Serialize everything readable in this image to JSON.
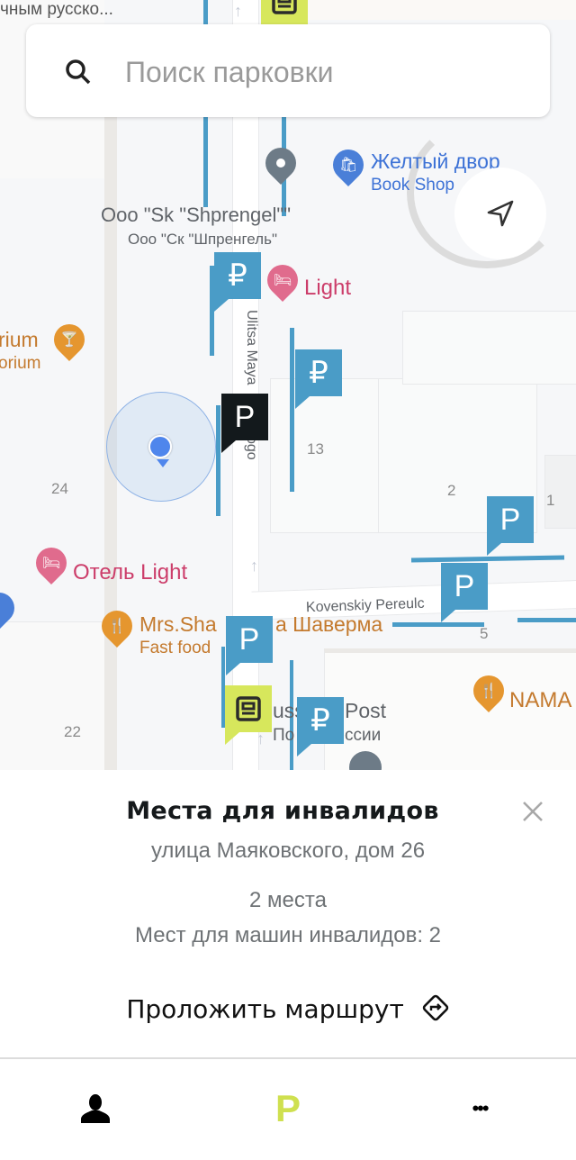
{
  "search": {
    "placeholder": "Поиск парковки"
  },
  "map": {
    "top_label": "чным русско...",
    "pois": [
      {
        "name": "Желтый двор",
        "sub": "Book Shop",
        "icon": "shopping-bag-icon",
        "color": "#4a7fd8"
      },
      {
        "name": "Ooo \"Sk \"Shprengel\"\"",
        "sub": "Ooo \"Ск \"Шпренгель\"",
        "icon": "place-pin-icon",
        "color": "#6d7b87"
      },
      {
        "name": "Light",
        "icon": "hotel-bed-icon",
        "color": "#d9486f"
      },
      {
        "name": "rium",
        "sub": "orium",
        "icon": "cocktail-icon",
        "color": "#e5962f"
      },
      {
        "name": "Отель Light",
        "icon": "hotel-bed-icon",
        "color": "#d9486f"
      },
      {
        "name": "Mrs.Shaverma Шаверма",
        "name_visible_left": "Mrs.Sha",
        "name_visible_right": "a Шаверма",
        "sub": "Fast food",
        "icon": "restaurant-icon",
        "color": "#e5962f"
      },
      {
        "name": "NAMA",
        "icon": "restaurant-icon",
        "color": "#e5962f"
      },
      {
        "name": "Russian Post",
        "name_visible_left": "uss",
        "name_visible_right": "Post",
        "sub_left": "По",
        "sub_right": "ссии",
        "icon": "mail-icon",
        "color": "#6d7b87"
      }
    ],
    "streets": [
      "Ulitsa Maya",
      "ogo",
      "Kovenskiy Pereulc"
    ],
    "house_numbers": [
      "24",
      "13",
      "2",
      "1",
      "5",
      "22"
    ],
    "parking_markers": [
      {
        "type": "paid",
        "glyph": "₽"
      },
      {
        "type": "paid",
        "glyph": "₽"
      },
      {
        "type": "selected",
        "glyph": "P"
      },
      {
        "type": "free",
        "glyph": "P"
      },
      {
        "type": "free",
        "glyph": "P"
      },
      {
        "type": "free",
        "glyph": "P"
      },
      {
        "type": "paid",
        "glyph": "₽"
      },
      {
        "type": "terminal",
        "glyph": "terminal-icon"
      },
      {
        "type": "terminal",
        "glyph": "terminal-icon"
      }
    ]
  },
  "details": {
    "title": "Места для инвалидов",
    "address": "улица Маяковского, дом 26",
    "places": "2 места",
    "disabled_places": "Мест для машин инвалидов: 2",
    "route_label": "Проложить маршрут"
  },
  "tabs": [
    {
      "name": "profile",
      "icon": "person-icon",
      "glyph": ""
    },
    {
      "name": "parking",
      "icon": "parking-icon",
      "glyph": "P",
      "active": true
    },
    {
      "name": "more",
      "icon": "more-icon",
      "glyph": "•••"
    }
  ],
  "colors": {
    "accent": "#cfe04f",
    "parking_paid": "#4a9cc7",
    "parking_selected": "#13191c",
    "terminal": "#d7e75c",
    "user_location": "#4f86ec"
  }
}
